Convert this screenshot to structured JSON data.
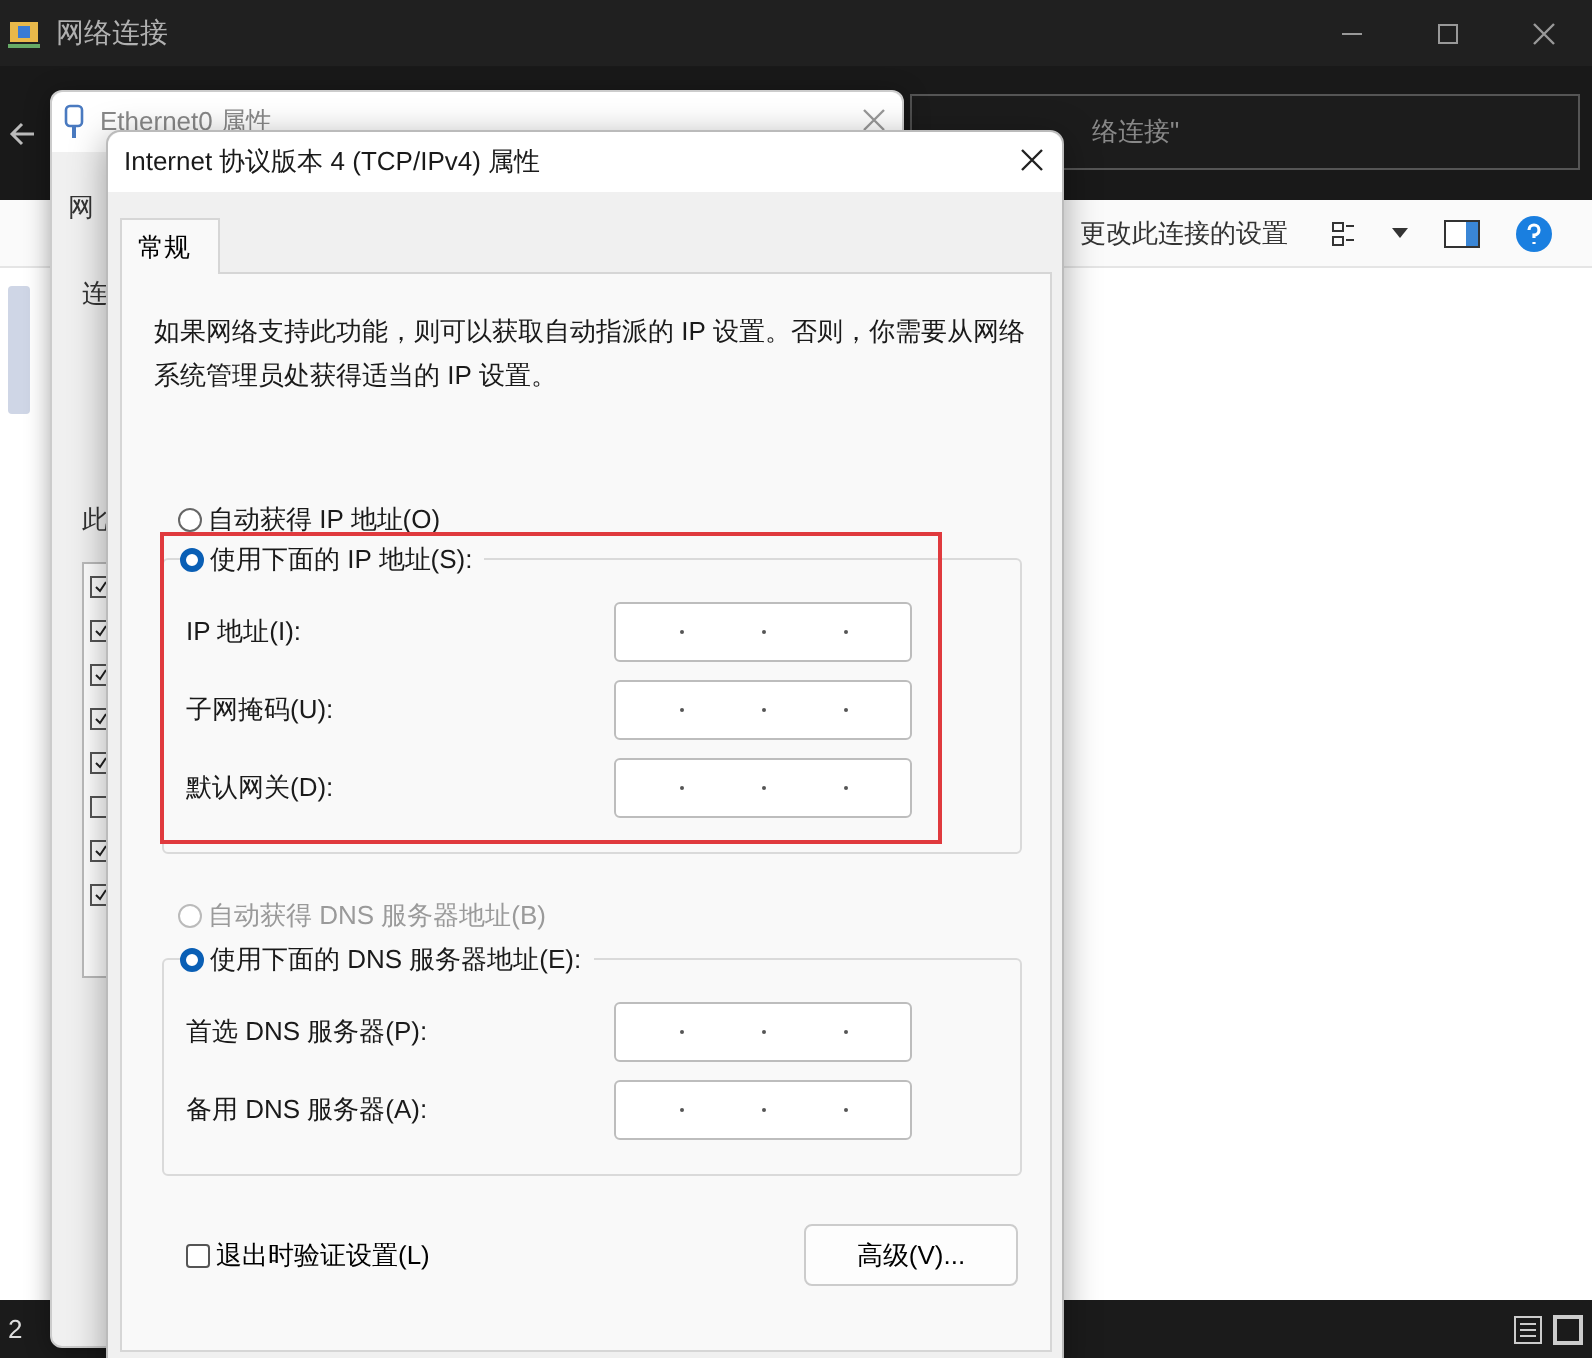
{
  "explorer": {
    "title": "网络连接",
    "search": {
      "placeholder": "络连接\""
    },
    "toolbar": {
      "command": "更改此连接的设置"
    },
    "status_bar": {
      "item_count": "2"
    }
  },
  "ethernet_dialog": {
    "title": "Ethernet0 属性",
    "tab_fragment": "网",
    "label_fragments": [
      "连",
      "此"
    ],
    "components": [
      {
        "checked": true
      },
      {
        "checked": true
      },
      {
        "checked": true
      },
      {
        "checked": true
      },
      {
        "checked": true
      },
      {
        "checked": false
      },
      {
        "checked": true
      },
      {
        "checked": true
      }
    ]
  },
  "ipv4_dialog": {
    "title": "Internet 协议版本 4 (TCP/IPv4) 属性",
    "tabs": [
      {
        "label": "常规",
        "selected": true
      }
    ],
    "description": "如果网络支持此功能，则可以获取自动指派的 IP 设置。否则，你需要从网络系统管理员处获得适当的 IP 设置。",
    "ip_options": [
      {
        "label": "自动获得 IP 地址(O)",
        "selected": false,
        "disabled": false
      },
      {
        "label": "使用下面的 IP 地址(S):",
        "selected": true,
        "disabled": false
      }
    ],
    "ip_fields": [
      {
        "label": "IP 地址(I):"
      },
      {
        "label": "子网掩码(U):"
      },
      {
        "label": "默认网关(D):"
      }
    ],
    "dns_options": [
      {
        "label": "自动获得 DNS 服务器地址(B)",
        "selected": false,
        "disabled": true
      },
      {
        "label": "使用下面的 DNS 服务器地址(E):",
        "selected": true,
        "disabled": false
      }
    ],
    "dns_fields": [
      {
        "label": "首选 DNS 服务器(P):"
      },
      {
        "label": "备用 DNS 服务器(A):"
      }
    ],
    "validate_checkbox": {
      "label": "退出时验证设置(L)",
      "checked": false
    },
    "advanced_button": "高级(V)..."
  }
}
